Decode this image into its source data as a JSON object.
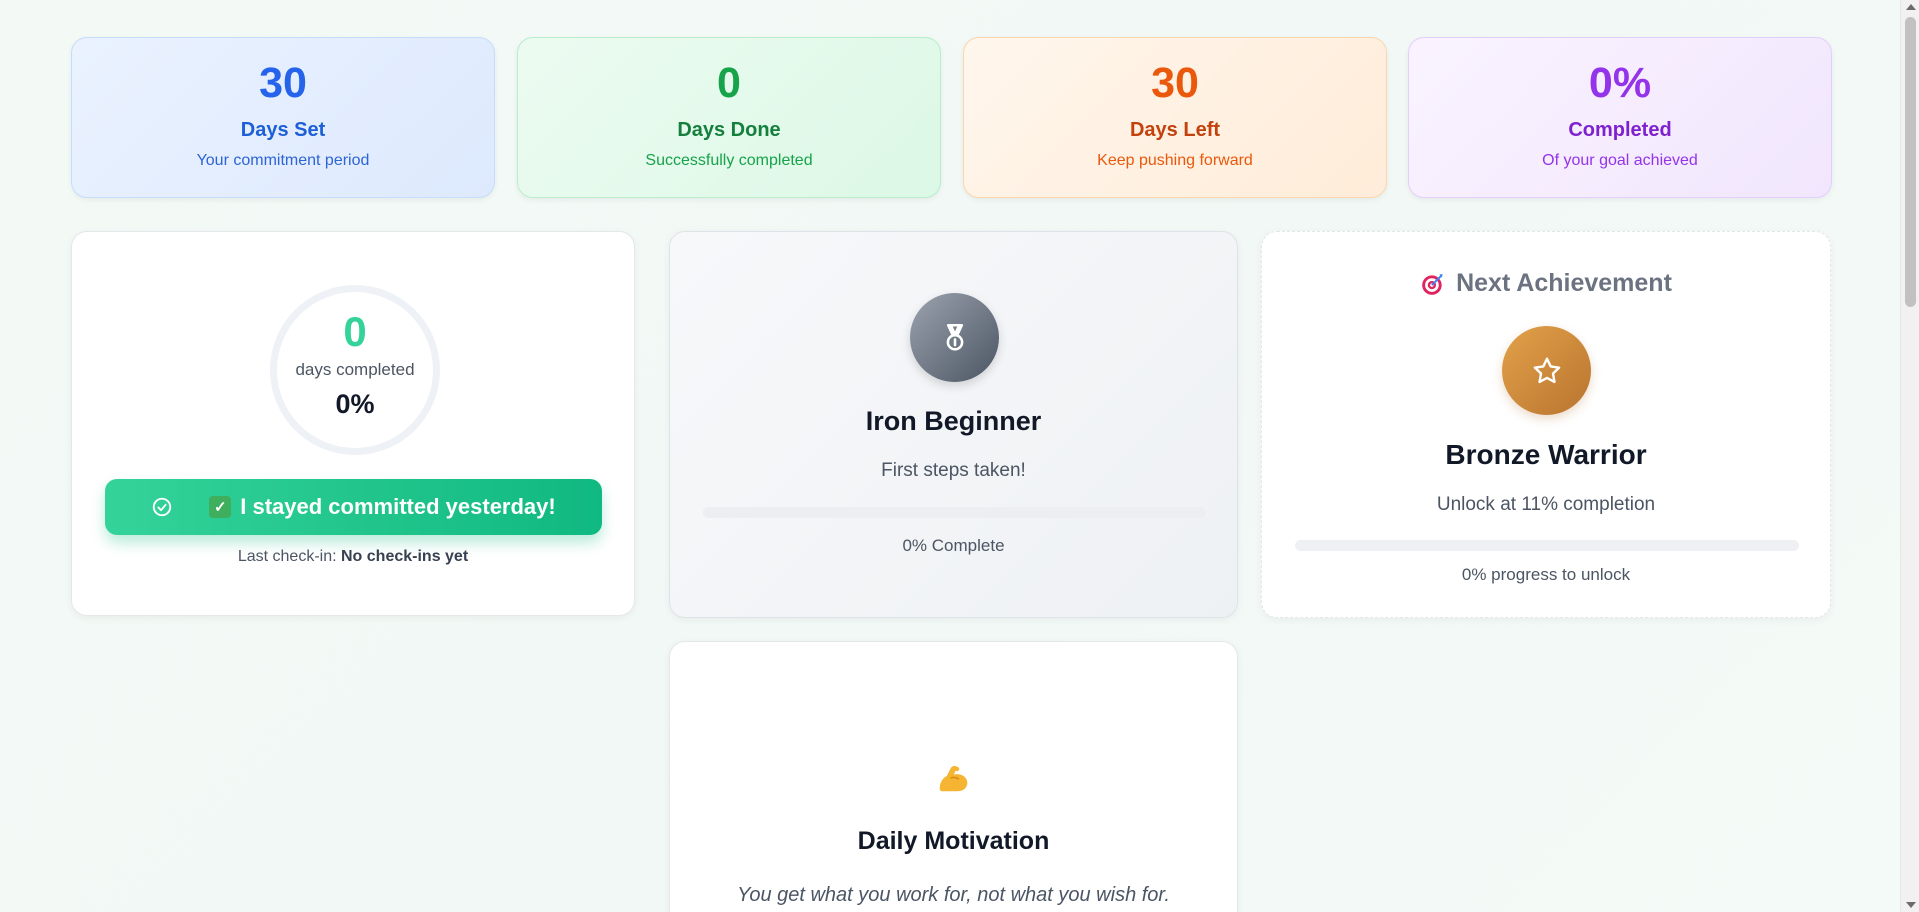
{
  "stats": [
    {
      "value": "30",
      "title": "Days Set",
      "subtitle": "Your commitment period"
    },
    {
      "value": "0",
      "title": "Days Done",
      "subtitle": "Successfully completed"
    },
    {
      "value": "30",
      "title": "Days Left",
      "subtitle": "Keep pushing forward"
    },
    {
      "value": "0%",
      "title": "Completed",
      "subtitle": "Of your goal achieved"
    }
  ],
  "progress": {
    "count": "0",
    "count_label": "days completed",
    "percent": "0%",
    "percent_fraction": 0,
    "checkin_button": "I stayed committed yesterday!",
    "checkin_icon": "check-circle-icon",
    "checkin_emoji_icon": "check-box-icon",
    "last_checkin_label": "Last check-in:",
    "last_checkin_value": "No check-ins yet"
  },
  "current_badge": {
    "icon": "medal-icon",
    "title": "Iron Beginner",
    "description": "First steps taken!",
    "progress_text": "0% Complete",
    "progress_fraction": 0
  },
  "next_achievement": {
    "heading": "Next Achievement",
    "heading_icon": "target-icon",
    "icon": "star-icon",
    "title": "Bronze Warrior",
    "description": "Unlock at 11% completion",
    "progress_text": "0% progress to unlock",
    "progress_fraction": 0
  },
  "motivation": {
    "icon": "flexed-biceps-icon",
    "title": "Daily Motivation",
    "quote": "You get what you work for, not what you wish for."
  },
  "colors": {
    "blue": "#2563eb",
    "green": "#16a34a",
    "orange": "#ea580c",
    "purple": "#9333ea",
    "accent": "#10b981",
    "bronze": "#c98438"
  }
}
